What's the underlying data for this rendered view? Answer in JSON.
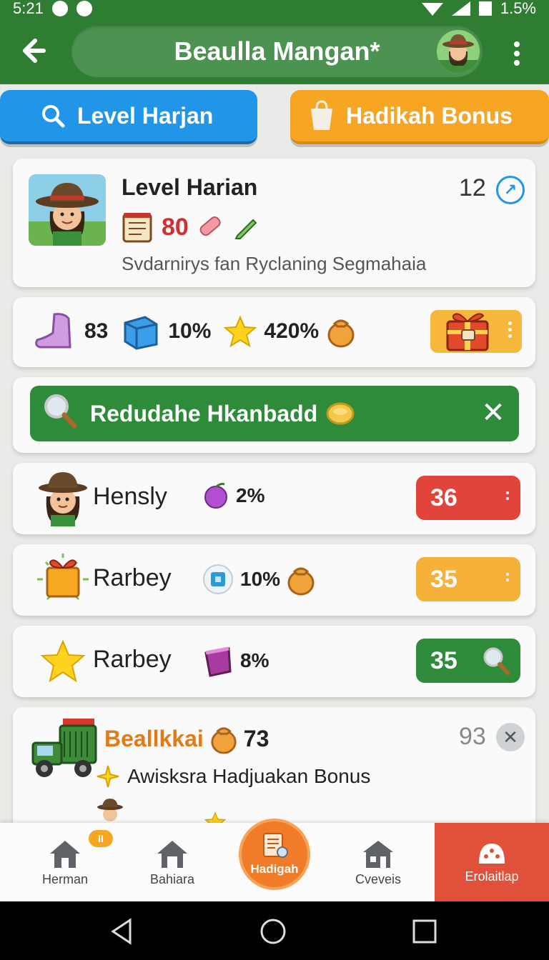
{
  "status": {
    "time": "5:21",
    "battery": "1.5%"
  },
  "appbar": {
    "title": "Beaulla Mangan*"
  },
  "tabs": [
    {
      "label": "Level Harjan",
      "icon": "search-icon"
    },
    {
      "label": "Hadikah Bonus",
      "icon": "gift-bag-icon"
    }
  ],
  "header_card": {
    "title": "Level Harian",
    "number": "12",
    "score": "80",
    "subtitle": "Svdarnirys fan Ryclaning Segmahaia"
  },
  "stats": [
    {
      "icon": "boot-icon",
      "value": "83"
    },
    {
      "icon": "box-icon",
      "value": "10%"
    },
    {
      "icon": "star-icon",
      "value": "420%"
    },
    {
      "icon": "coin-bag-icon",
      "value": ""
    }
  ],
  "search": {
    "text": "Redudahe Hkanbadd"
  },
  "rows": [
    {
      "name": "Hensly",
      "mid_value": "2%",
      "badge": "36",
      "badge_color": "#e0443a"
    },
    {
      "name": "Rarbey",
      "mid_value": "10%",
      "badge": "35",
      "badge_color": "#f6b13a"
    },
    {
      "name": "Rarbey",
      "mid_value": "8%",
      "badge": "35",
      "badge_color": "#2e8b3a"
    }
  ],
  "bottom_card": {
    "title": "Beallkkai",
    "count": "73",
    "right_number": "93",
    "subtitle": "Awisksra Hadjuakan Bonus"
  },
  "bottomnav": {
    "items": [
      {
        "label": "Herman",
        "badge": "II"
      },
      {
        "label": "Bahiara"
      },
      {
        "label": "Hadigah"
      },
      {
        "label": "Cveveis"
      },
      {
        "label": "Erolaitlap"
      }
    ]
  }
}
